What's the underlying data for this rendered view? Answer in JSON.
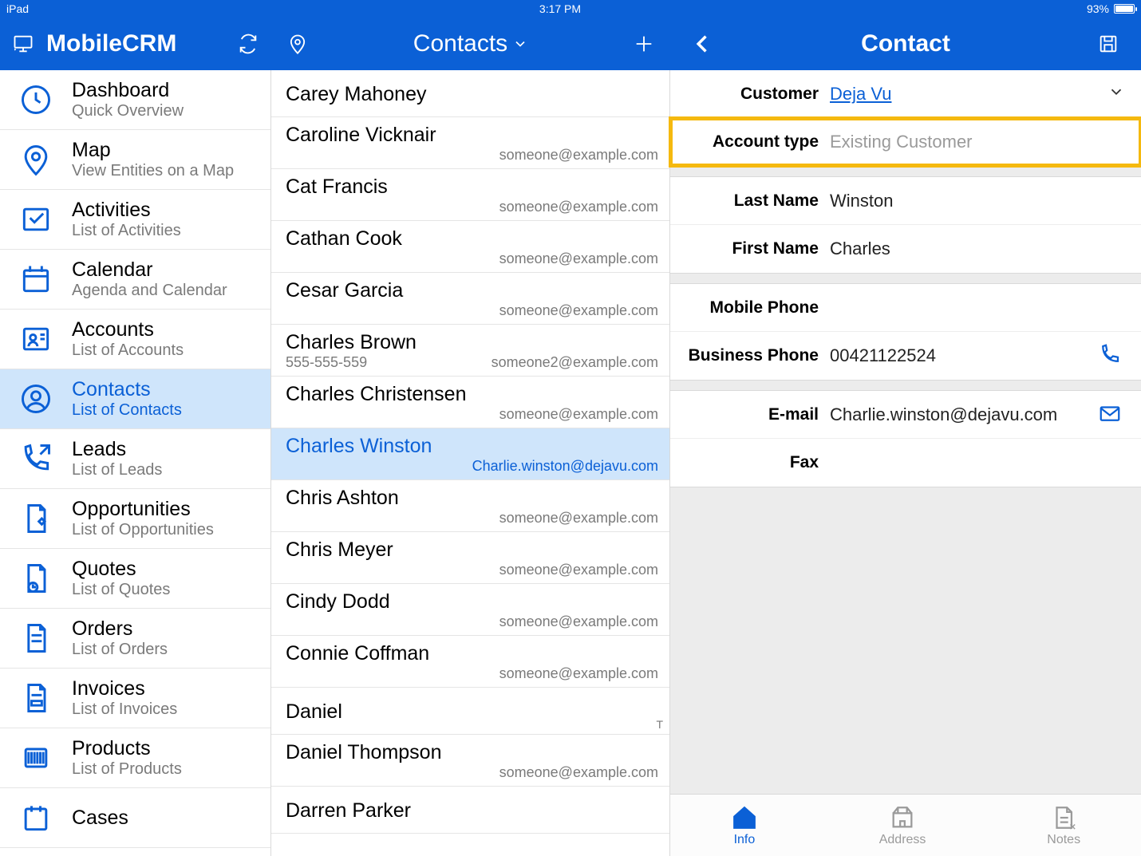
{
  "status": {
    "device": "iPad",
    "time": "3:17 PM",
    "battery": "93%"
  },
  "app": {
    "title": "MobileCRM"
  },
  "middle_header": {
    "title": "Contacts"
  },
  "right_header": {
    "title": "Contact"
  },
  "sidebar": {
    "items": [
      {
        "title": "Dashboard",
        "subtitle": "Quick Overview"
      },
      {
        "title": "Map",
        "subtitle": "View Entities on a Map"
      },
      {
        "title": "Activities",
        "subtitle": "List of Activities"
      },
      {
        "title": "Calendar",
        "subtitle": "Agenda and Calendar"
      },
      {
        "title": "Accounts",
        "subtitle": "List of Accounts"
      },
      {
        "title": "Contacts",
        "subtitle": "List of Contacts"
      },
      {
        "title": "Leads",
        "subtitle": "List of Leads"
      },
      {
        "title": "Opportunities",
        "subtitle": "List of Opportunities"
      },
      {
        "title": "Quotes",
        "subtitle": "List of Quotes"
      },
      {
        "title": "Orders",
        "subtitle": "List of Orders"
      },
      {
        "title": "Invoices",
        "subtitle": "List of Invoices"
      },
      {
        "title": "Products",
        "subtitle": "List of Products"
      },
      {
        "title": "Cases",
        "subtitle": ""
      }
    ],
    "selected_index": 5
  },
  "contacts": {
    "selected_index": 6,
    "items": [
      {
        "name": "Carey Mahoney",
        "phone": "",
        "email": ""
      },
      {
        "name": "Caroline Vicknair",
        "phone": "",
        "email": "someone@example.com"
      },
      {
        "name": "Cat Francis",
        "phone": "",
        "email": "someone@example.com"
      },
      {
        "name": "Cathan Cook",
        "phone": "",
        "email": "someone@example.com"
      },
      {
        "name": "Cesar Garcia",
        "phone": "",
        "email": "someone@example.com"
      },
      {
        "name": "Charles Brown",
        "phone": "555-555-559",
        "email": "someone2@example.com"
      },
      {
        "name": "Charles Christensen",
        "phone": "",
        "email": "someone@example.com"
      },
      {
        "name": "Charles Winston",
        "phone": "",
        "email": "Charlie.winston@dejavu.com"
      },
      {
        "name": "Chris Ashton",
        "phone": "",
        "email": "someone@example.com"
      },
      {
        "name": "Chris Meyer",
        "phone": "",
        "email": "someone@example.com"
      },
      {
        "name": "Cindy Dodd",
        "phone": "",
        "email": "someone@example.com"
      },
      {
        "name": "Connie Coffman",
        "phone": "",
        "email": "someone@example.com"
      },
      {
        "name": "Daniel",
        "phone": "",
        "email": "",
        "tag": "T"
      },
      {
        "name": "Daniel Thompson",
        "phone": "",
        "email": "someone@example.com"
      },
      {
        "name": "Darren Parker",
        "phone": "",
        "email": ""
      }
    ]
  },
  "detail": {
    "fields": {
      "customer": {
        "label": "Customer",
        "value": "Deja Vu"
      },
      "account_type": {
        "label": "Account type",
        "value": "Existing Customer"
      },
      "last_name": {
        "label": "Last Name",
        "value": "Winston"
      },
      "first_name": {
        "label": "First Name",
        "value": "Charles"
      },
      "mobile_phone": {
        "label": "Mobile Phone",
        "value": ""
      },
      "business_phone": {
        "label": "Business Phone",
        "value": "00421122524"
      },
      "email": {
        "label": "E-mail",
        "value": "Charlie.winston@dejavu.com"
      },
      "fax": {
        "label": "Fax",
        "value": ""
      }
    },
    "tabs": {
      "info": "Info",
      "address": "Address",
      "notes": "Notes",
      "active": "info"
    }
  }
}
